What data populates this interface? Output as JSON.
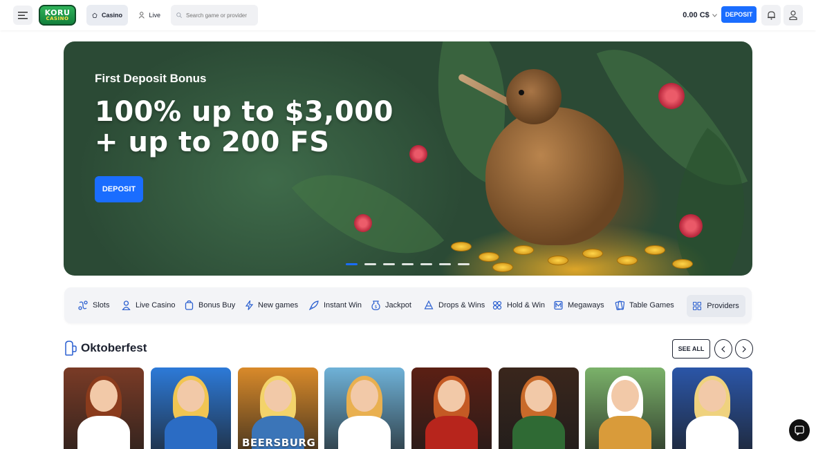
{
  "header": {
    "logo": {
      "line1": "KORU",
      "line2": "CASINO"
    },
    "tabs": [
      {
        "label": "Casino",
        "icon": "casino-icon",
        "active": true
      },
      {
        "label": "Live",
        "icon": "live-dealer-icon",
        "active": false
      }
    ],
    "search": {
      "placeholder": "Search game or provider",
      "value": ""
    },
    "balance": "0.00 C$",
    "deposit_label": "DEPOSIT",
    "icons": [
      "menu-icon",
      "bell-icon",
      "user-icon",
      "chevron-down-icon",
      "search-icon"
    ]
  },
  "banner": {
    "subtitle": "First Deposit Bonus",
    "title_line1": "100% up to $3,000",
    "title_line2": "+ up to 200 FS",
    "button_label": "DEPOSIT",
    "slides_total": 7,
    "active_slide": 1
  },
  "categories": [
    {
      "label": "Slots",
      "icon": "slots-icon"
    },
    {
      "label": "Live Casino",
      "icon": "live-casino-icon"
    },
    {
      "label": "Bonus Buy",
      "icon": "bonus-buy-icon"
    },
    {
      "label": "New games",
      "icon": "lightning-icon"
    },
    {
      "label": "Instant Win",
      "icon": "rocket-icon"
    },
    {
      "label": "Jackpot",
      "icon": "jackpot-icon"
    },
    {
      "label": "Drops & Wins",
      "icon": "drops-wins-icon"
    },
    {
      "label": "Hold & Win",
      "icon": "hold-win-icon"
    },
    {
      "label": "Megaways",
      "icon": "megaways-icon"
    },
    {
      "label": "Table Games",
      "icon": "table-games-icon"
    }
  ],
  "providers_label": "Providers",
  "section": {
    "title": "Oktoberfest",
    "icon": "beer-mug-icon",
    "see_all_label": "SEE ALL"
  },
  "games": [
    {
      "caption": "",
      "bg": "#7a3b26",
      "hair": "#8a3b1c",
      "dress": "#ffffff"
    },
    {
      "caption": "",
      "bg": "#2d7ad8",
      "hair": "#f1c552",
      "dress": "#2b6cc4"
    },
    {
      "caption": "BEERSBURG",
      "bg": "#d98a2a",
      "hair": "#f3d36a",
      "dress": "#3b75b8"
    },
    {
      "caption": "",
      "bg": "#6fb2d8",
      "hair": "#e9b050",
      "dress": "#ffffff"
    },
    {
      "caption": "",
      "bg": "#5b1f14",
      "hair": "#c45a24",
      "dress": "#b7251c"
    },
    {
      "caption": "",
      "bg": "#3a261c",
      "hair": "#c86a2a",
      "dress": "#2f6a34"
    },
    {
      "caption": "",
      "bg": "#7bb26a",
      "hair": "#ffffff",
      "dress": "#d99b3a"
    },
    {
      "caption": "",
      "bg": "#2b56a8",
      "hair": "#efd27e",
      "dress": "#ffffff"
    }
  ],
  "colors": {
    "accent": "#1a6dff",
    "text": "#1d2230",
    "surface": "#f3f4f7"
  }
}
